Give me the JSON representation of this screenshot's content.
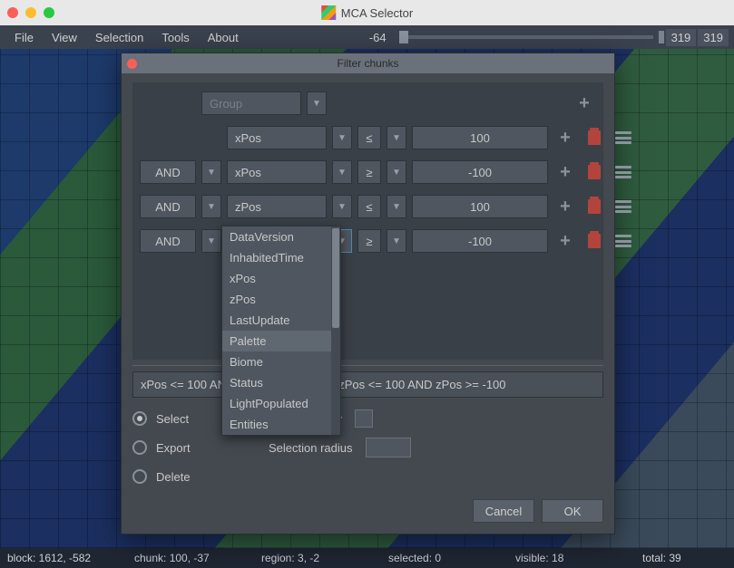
{
  "window": {
    "title": "MCA Selector"
  },
  "menu": {
    "items": [
      "File",
      "View",
      "Selection",
      "Tools",
      "About"
    ],
    "coord_left": "-64",
    "coord_r1": "319",
    "coord_r2": "319"
  },
  "dialog": {
    "title": "Filter chunks",
    "group_label": "Group",
    "rows": [
      {
        "logic": "",
        "field": "xPos",
        "op": "≤",
        "value": "100"
      },
      {
        "logic": "AND",
        "field": "xPos",
        "op": "≥",
        "value": "-100"
      },
      {
        "logic": "AND",
        "field": "zPos",
        "op": "≤",
        "value": "100"
      },
      {
        "logic": "AND",
        "field": "zPos",
        "op": "≥",
        "value": "-100"
      }
    ],
    "dropdown_options": [
      "DataVersion",
      "InhabitedTime",
      "xPos",
      "zPos",
      "LastUpdate",
      "Palette",
      "Biome",
      "Status",
      "LightPopulated",
      "Entities"
    ],
    "dropdown_highlight": "Palette",
    "expression": "xPos <= 100 AND xPos >= -100 AND zPos <= 100 AND zPos >= -100",
    "expression_visible_left": "xPos <= 100 A",
    "expression_visible_right": ") zPos <= 100 AND zPos >= -100",
    "actions": {
      "select": "Select",
      "export": "Export",
      "delete": "Delete"
    },
    "opts": {
      "selection_only": "Selection only",
      "selection_radius": "Selection radius"
    },
    "buttons": {
      "cancel": "Cancel",
      "ok": "OK"
    }
  },
  "status": {
    "block": "block: 1612, -582",
    "chunk": "chunk: 100, -37",
    "region": "region: 3, -2",
    "selected": "selected: 0",
    "visible": "visible: 18",
    "total": "total: 39"
  }
}
